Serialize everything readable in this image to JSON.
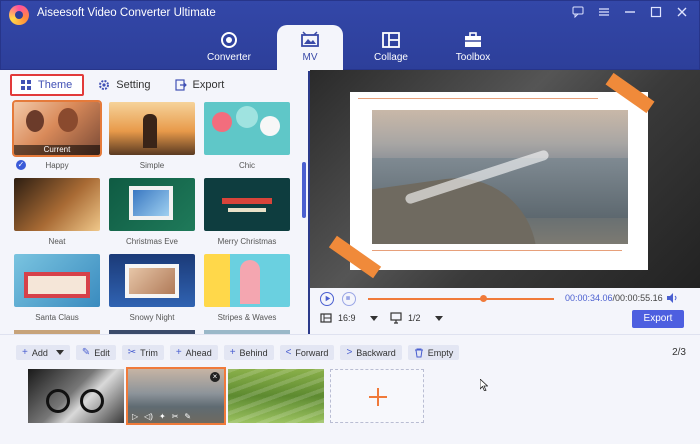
{
  "app": {
    "title": "Aiseesoft Video Converter Ultimate"
  },
  "window_controls": [
    "chat-icon",
    "menu-icon",
    "minimize-icon",
    "maximize-icon",
    "close-icon"
  ],
  "nav": [
    {
      "label": "Converter",
      "icon": "converter-icon"
    },
    {
      "label": "MV",
      "icon": "mv-icon",
      "active": true
    },
    {
      "label": "Collage",
      "icon": "collage-icon"
    },
    {
      "label": "Toolbox",
      "icon": "toolbox-icon"
    }
  ],
  "subtabs": [
    {
      "label": "Theme",
      "icon": "grid-icon",
      "active": true
    },
    {
      "label": "Setting",
      "icon": "gear-icon"
    },
    {
      "label": "Export",
      "icon": "export-icon"
    }
  ],
  "themes": [
    {
      "name": "Happy",
      "selected": true,
      "tag": "Current"
    },
    {
      "name": "Simple"
    },
    {
      "name": "Chic"
    },
    {
      "name": "Neat"
    },
    {
      "name": "Christmas Eve"
    },
    {
      "name": "Merry Christmas"
    },
    {
      "name": "Santa Claus"
    },
    {
      "name": "Snowy Night"
    },
    {
      "name": "Stripes & Waves"
    }
  ],
  "player": {
    "current_time": "00:00:34.06",
    "total_time": "/00:00:55.16",
    "progress": 0.62,
    "aspect_ratio": "16:9",
    "page": "1/2",
    "export_label": "Export"
  },
  "timeline": {
    "buttons": [
      {
        "label": "Add",
        "icon": "+"
      },
      {
        "label": "Edit",
        "icon": "✎"
      },
      {
        "label": "Trim",
        "icon": "✂"
      },
      {
        "label": "Ahead",
        "icon": "+"
      },
      {
        "label": "Behind",
        "icon": "+"
      },
      {
        "label": "Forward",
        "icon": "<"
      },
      {
        "label": "Backward",
        "icon": ">"
      },
      {
        "label": "Empty",
        "icon": "🗑"
      }
    ],
    "page_count": "2/3"
  },
  "colors": {
    "brand": "#2d3f9a",
    "accent": "#f07a3a",
    "primary_button": "#4d5fe0"
  }
}
